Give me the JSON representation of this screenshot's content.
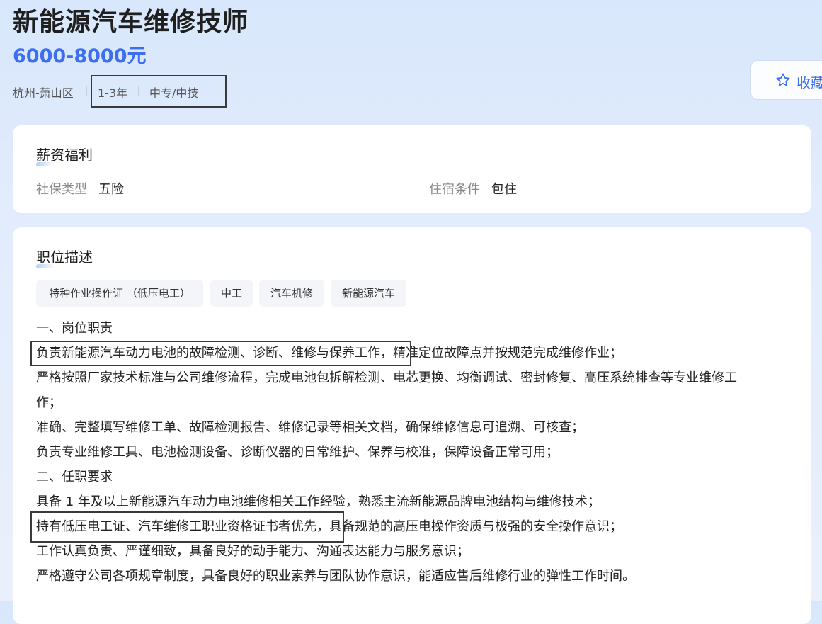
{
  "job": {
    "title": "新能源汽车维修技师",
    "salary": "6000-8000元",
    "location": "杭州-萧山区",
    "experience": "1-3年",
    "education": "中专/中技"
  },
  "actions": {
    "favorite_label": "收藏",
    "favorite_icon": "star-outline-icon"
  },
  "benefits": {
    "title": "薪资福利",
    "items": [
      {
        "label": "社保类型",
        "value": "五险"
      },
      {
        "label": "住宿条件",
        "value": "包住"
      }
    ]
  },
  "description": {
    "title": "职位描述",
    "tags": [
      "特种作业操作证 （低压电工）",
      "中工",
      "汽车机修",
      "新能源汽车"
    ],
    "lines": [
      "一、岗位职责",
      "负责新能源汽车动力电池的故障检测、诊断、维修与保养工作，精准定位故障点并按规范完成维修作业；",
      "严格按照厂家技术标准与公司维修流程，完成电池包拆解检测、电芯更换、均衡调试、密封修复、高压系统排查等专业维修工",
      "作；",
      "准确、完整填写维修工单、故障检测报告、维修记录等相关文档，确保维修信息可追溯、可核查；",
      "负责专业维修工具、电池检测设备、诊断仪器的日常维护、保养与校准，保障设备正常可用；",
      "二、任职要求",
      "具备 1 年及以上新能源汽车动力电池维修相关工作经验，熟悉主流新能源品牌电池结构与维修技术；",
      "持有低压电工证、汽车维修工职业资格证书者优先，具备规范的高压电操作资质与极强的安全操作意识；",
      "工作认真负责、严谨细致，具备良好的动手能力、沟通表达能力与服务意识；",
      "严格遵守公司各项规章制度，具备良好的职业素养与团队协作意识，能适应售后维修行业的弹性工作时间。"
    ]
  },
  "colors": {
    "accent": "#3d6ef0",
    "highlight_border": "#3a3a3a"
  }
}
